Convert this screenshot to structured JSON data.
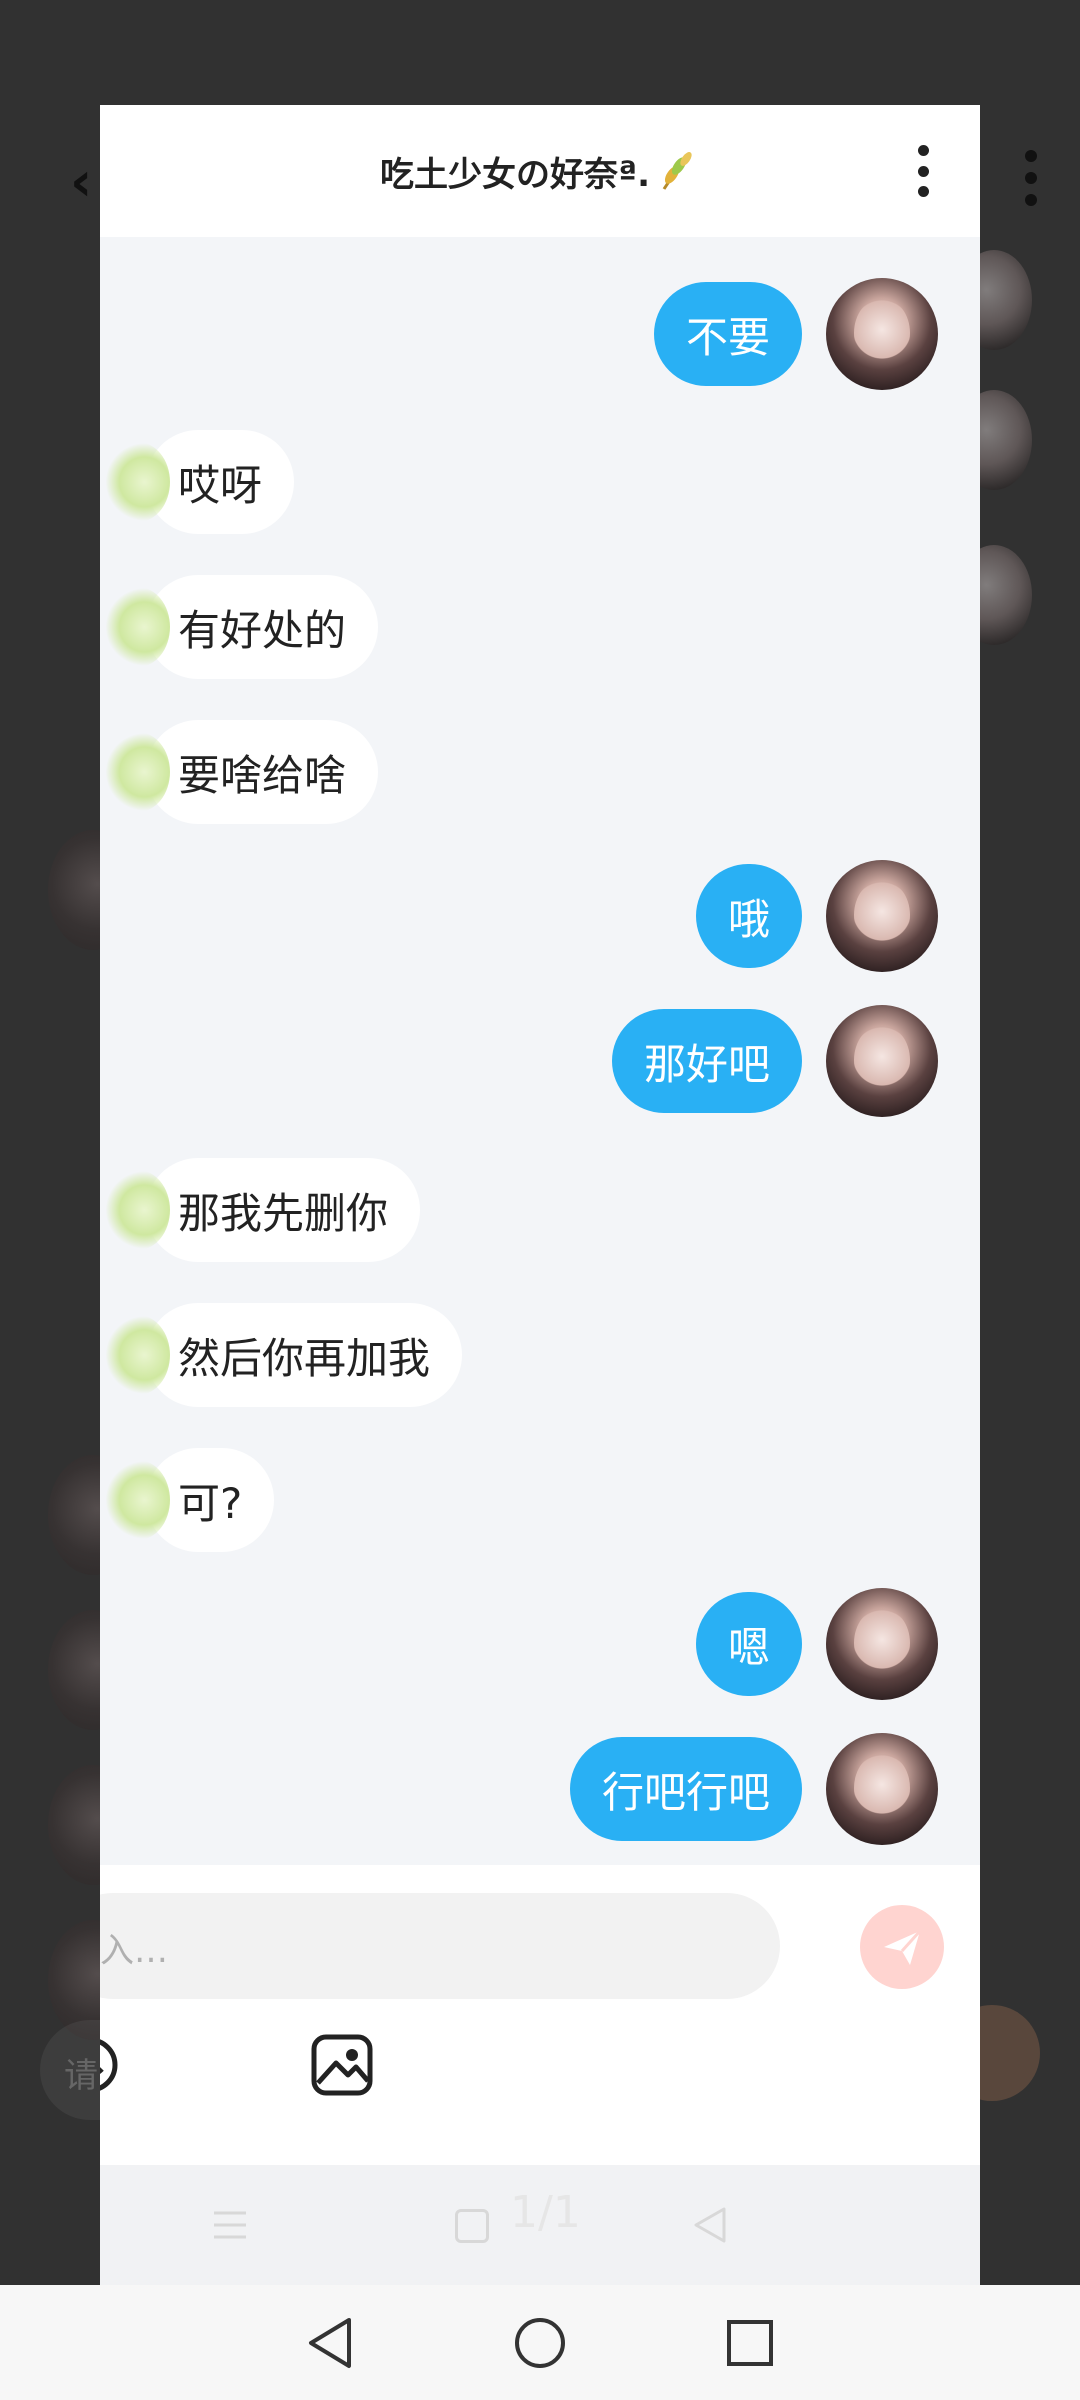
{
  "chat": {
    "title": "吃土少女の好奈ª.",
    "title_icon": "wheat-sprig-icon",
    "messages": [
      {
        "side": "out",
        "text": "不要"
      },
      {
        "side": "in",
        "text": "哎呀"
      },
      {
        "side": "in",
        "text": "有好处的"
      },
      {
        "side": "in",
        "text": "要啥给啥"
      },
      {
        "side": "out",
        "text": "哦"
      },
      {
        "side": "out",
        "text": "那好吧"
      },
      {
        "side": "in",
        "text": "那我先删你"
      },
      {
        "side": "in",
        "text": "然后你再加我"
      },
      {
        "side": "in",
        "text": "可?"
      },
      {
        "side": "out",
        "text": "嗯"
      },
      {
        "side": "out",
        "text": "行吧行吧"
      }
    ]
  },
  "input": {
    "placeholder": "入…",
    "background_placeholder": "请"
  },
  "preview": {
    "page_indicator": "1/1"
  },
  "colors": {
    "outgoing_bubble": "#29b0f4",
    "incoming_bubble": "#ffffff",
    "send_button": "#ffd4d0"
  }
}
